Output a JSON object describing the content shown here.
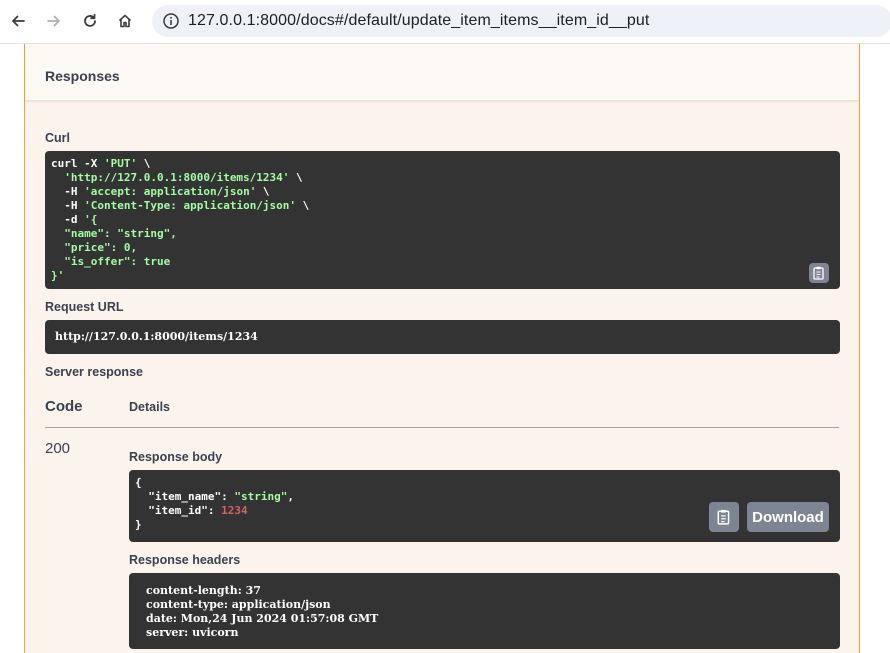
{
  "browser": {
    "url": "127.0.0.1:8000/docs#/default/update_item_items__item_id__put"
  },
  "responses": {
    "title": "Responses",
    "curl_label": "Curl",
    "curl_lines": [
      [
        {
          "t": "curl -X ",
          "c": ""
        },
        {
          "t": "'PUT'",
          "c": "s"
        },
        {
          "t": " \\",
          "c": ""
        }
      ],
      [
        {
          "t": "  ",
          "c": ""
        },
        {
          "t": "'http://127.0.0.1:8000/items/1234'",
          "c": "s"
        },
        {
          "t": " \\",
          "c": ""
        }
      ],
      [
        {
          "t": "  -H ",
          "c": ""
        },
        {
          "t": "'accept: application/json'",
          "c": "s"
        },
        {
          "t": " \\",
          "c": ""
        }
      ],
      [
        {
          "t": "  -H ",
          "c": ""
        },
        {
          "t": "'Content-Type: application/json'",
          "c": "s"
        },
        {
          "t": " \\",
          "c": ""
        }
      ],
      [
        {
          "t": "  -d ",
          "c": ""
        },
        {
          "t": "'{",
          "c": "s"
        }
      ],
      [
        {
          "t": "  \"name\": \"string\",",
          "c": "s"
        }
      ],
      [
        {
          "t": "  \"price\": 0,",
          "c": "s"
        }
      ],
      [
        {
          "t": "  \"is_offer\": true",
          "c": "s"
        }
      ],
      [
        {
          "t": "}'",
          "c": "s"
        }
      ]
    ],
    "request_url_label": "Request URL",
    "request_url": "http://127.0.0.1:8000/items/1234",
    "server_response_label": "Server response",
    "code_header": "Code",
    "details_header": "Details",
    "status_code": "200",
    "response_body_label": "Response body",
    "response_body_lines": [
      [
        {
          "t": "{",
          "c": ""
        }
      ],
      [
        {
          "t": "  \"item_name\": ",
          "c": ""
        },
        {
          "t": "\"string\"",
          "c": "s"
        },
        {
          "t": ",",
          "c": ""
        }
      ],
      [
        {
          "t": "  \"item_id\": ",
          "c": ""
        },
        {
          "t": "1234",
          "c": "n"
        }
      ],
      [
        {
          "t": "}",
          "c": ""
        }
      ]
    ],
    "download_label": "Download",
    "response_headers_label": "Response headers",
    "response_headers": [
      "content-length: 37",
      "content-type: application/json",
      "date: Mon,24 Jun 2024 01:57:08 GMT",
      "server: uvicorn"
    ]
  }
}
